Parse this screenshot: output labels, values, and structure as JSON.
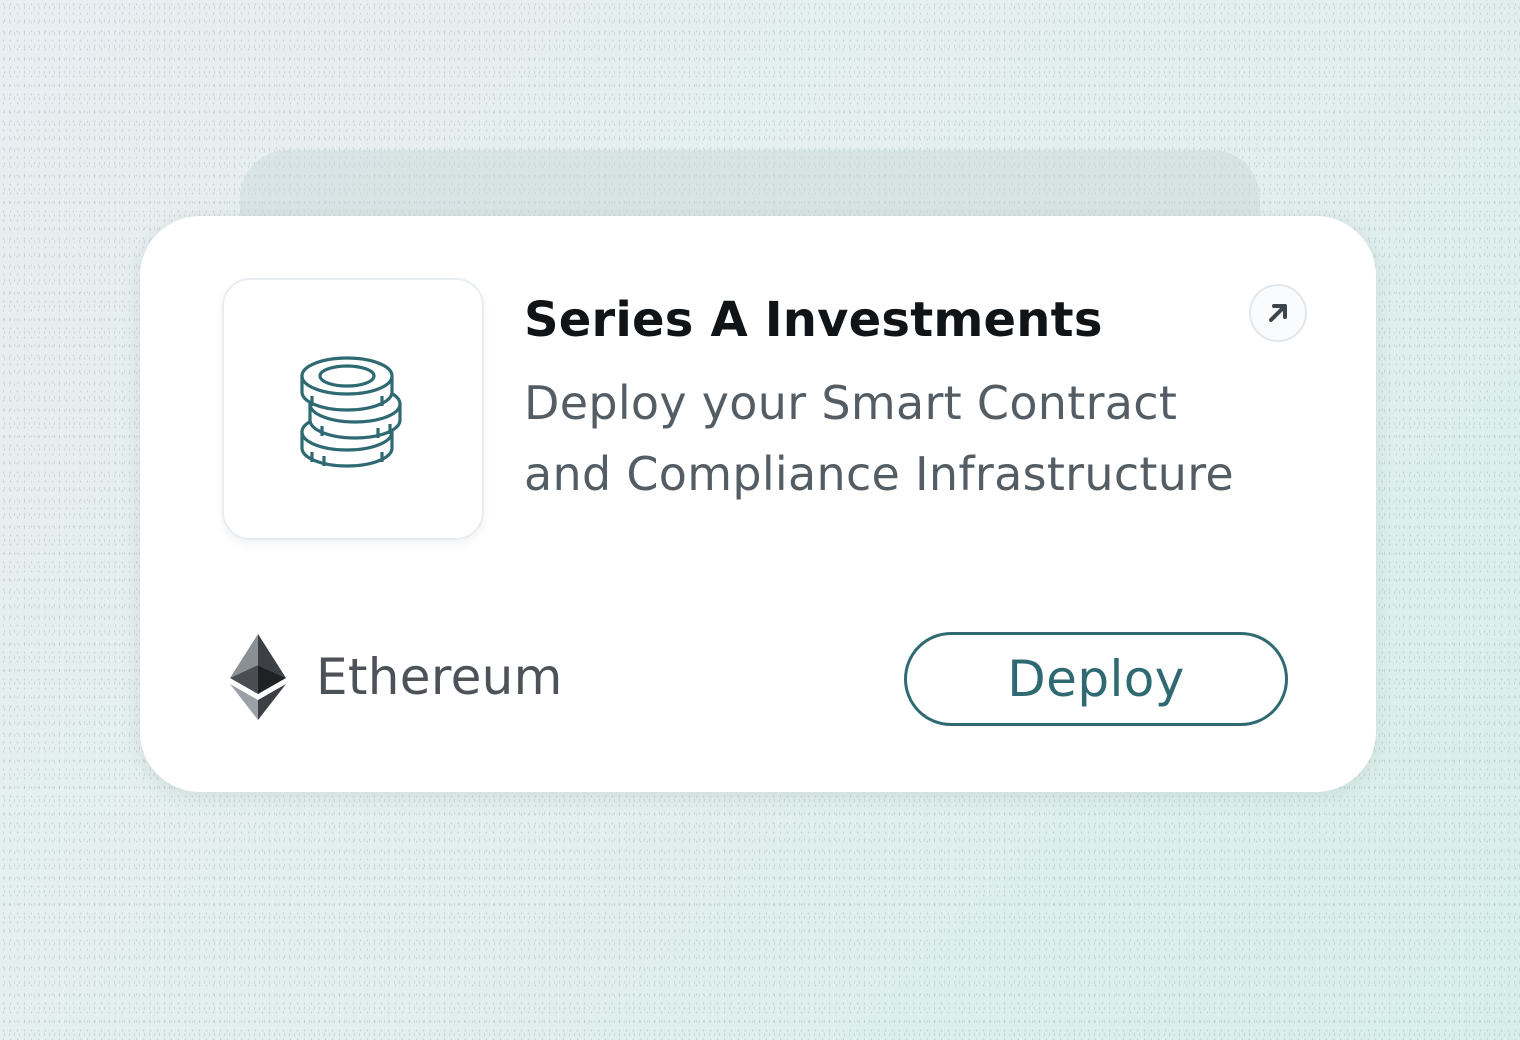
{
  "card": {
    "title": "Series A Investments",
    "description_line1": "Deploy your Smart Contract",
    "description_line2": "and Compliance Infrastructure",
    "icon": "coins-stack-icon",
    "open_icon": "arrow-up-right-icon",
    "network": {
      "icon": "ethereum-icon",
      "label": "Ethereum"
    },
    "deploy_label": "Deploy"
  },
  "colors": {
    "accent": "#2f6a72",
    "title": "#111417",
    "text_secondary": "#545c64"
  }
}
